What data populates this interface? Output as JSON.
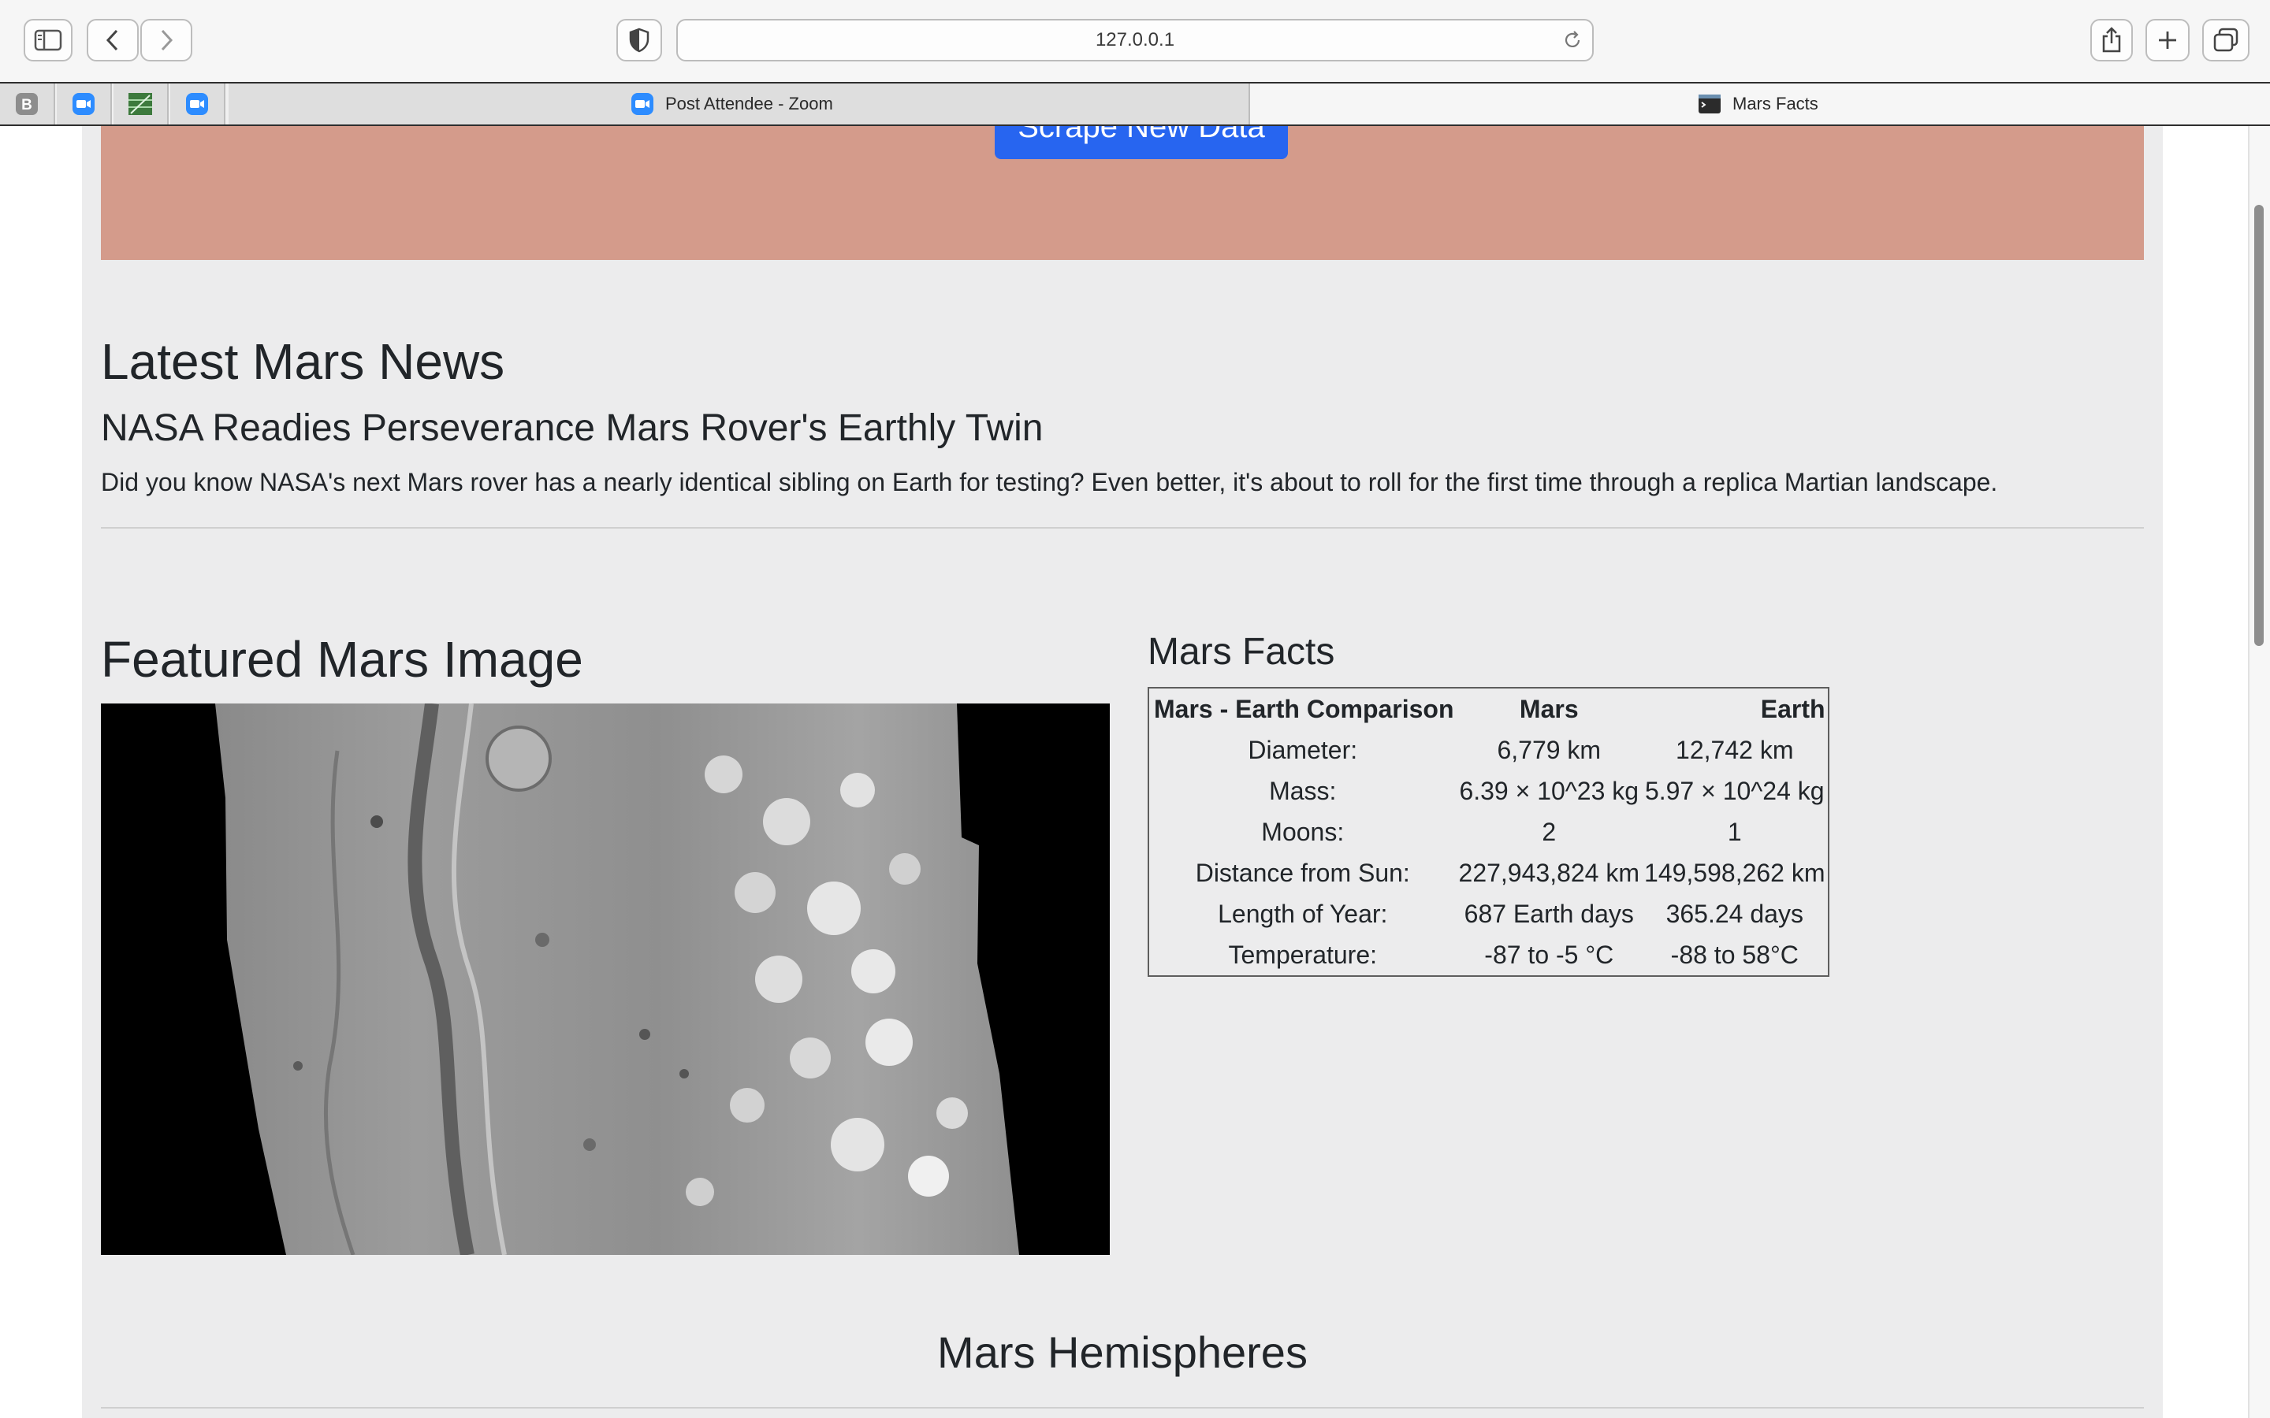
{
  "browser": {
    "url": "127.0.0.1",
    "tabs": [
      {
        "label": "Post Attendee - Zoom",
        "icon": "zoom-icon"
      },
      {
        "label": "Mars Facts",
        "icon": "terminal-icon"
      }
    ],
    "pinned_tabs": [
      "b-badge-icon",
      "zoom-icon",
      "spreadsheet-icon",
      "zoom-icon"
    ]
  },
  "jumbotron": {
    "button_label": "Scrape New Data",
    "background": "#d49b8b",
    "button_color": "#2765f0"
  },
  "news": {
    "heading": "Latest Mars News",
    "title": "NASA Readies Perseverance Mars Rover's Earthly Twin",
    "paragraph": "Did you know NASA's next Mars rover has a nearly identical sibling on Earth for testing? Even better, it's about to roll for the first time through a replica Martian landscape."
  },
  "featured": {
    "heading": "Featured Mars Image"
  },
  "facts": {
    "heading": "Mars Facts",
    "columns": [
      "Mars - Earth Comparison",
      "Mars",
      "Earth"
    ],
    "rows": [
      [
        "Diameter:",
        "6,779 km",
        "12,742 km"
      ],
      [
        "Mass:",
        "6.39 × 10^23 kg",
        "5.97 × 10^24 kg"
      ],
      [
        "Moons:",
        "2",
        "1"
      ],
      [
        "Distance from Sun:",
        "227,943,824 km",
        "149,598,262 km"
      ],
      [
        "Length of Year:",
        "687 Earth days",
        "365.24 days"
      ],
      [
        "Temperature:",
        "-87 to -5 °C",
        "-88 to 58°C"
      ]
    ]
  },
  "hemispheres": {
    "heading": "Mars Hemispheres"
  }
}
